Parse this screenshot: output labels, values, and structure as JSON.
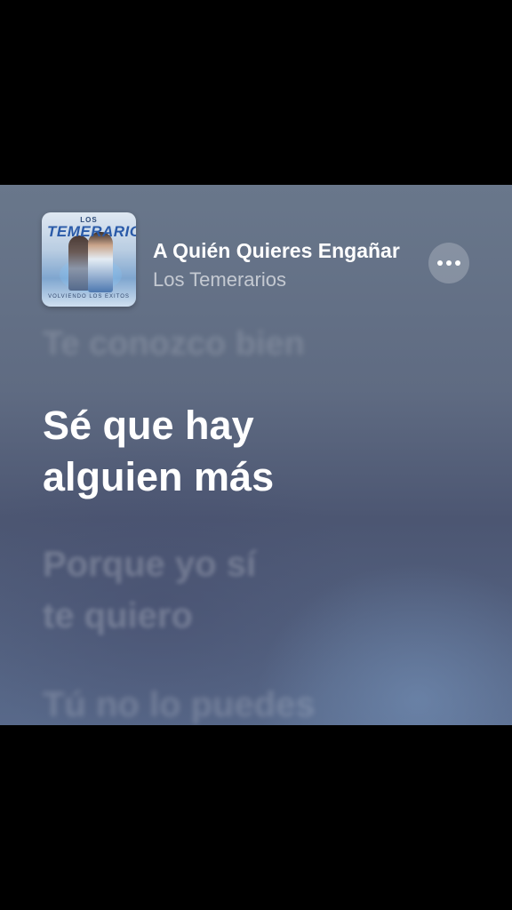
{
  "now_playing": {
    "title": "A Quién Quieres Engañar",
    "artist": "Los Temerarios",
    "more_icon": "ellipsis-icon"
  },
  "album_art": {
    "top_text": "LOS",
    "band_text": "TEMERARIOS",
    "bottom_text": "VOLVIENDO LOS EXITOS"
  },
  "lyrics": {
    "past_line": "Te conozco bien",
    "current": [
      "Sé que hay",
      "alguien más"
    ],
    "next_1": [
      "Porque yo sí",
      "te quiero"
    ],
    "next_2": "Tú no lo puedes"
  },
  "colors": {
    "background_top": "#69778b",
    "background_bottom": "#58698a",
    "active_lyric": "#ffffff"
  }
}
